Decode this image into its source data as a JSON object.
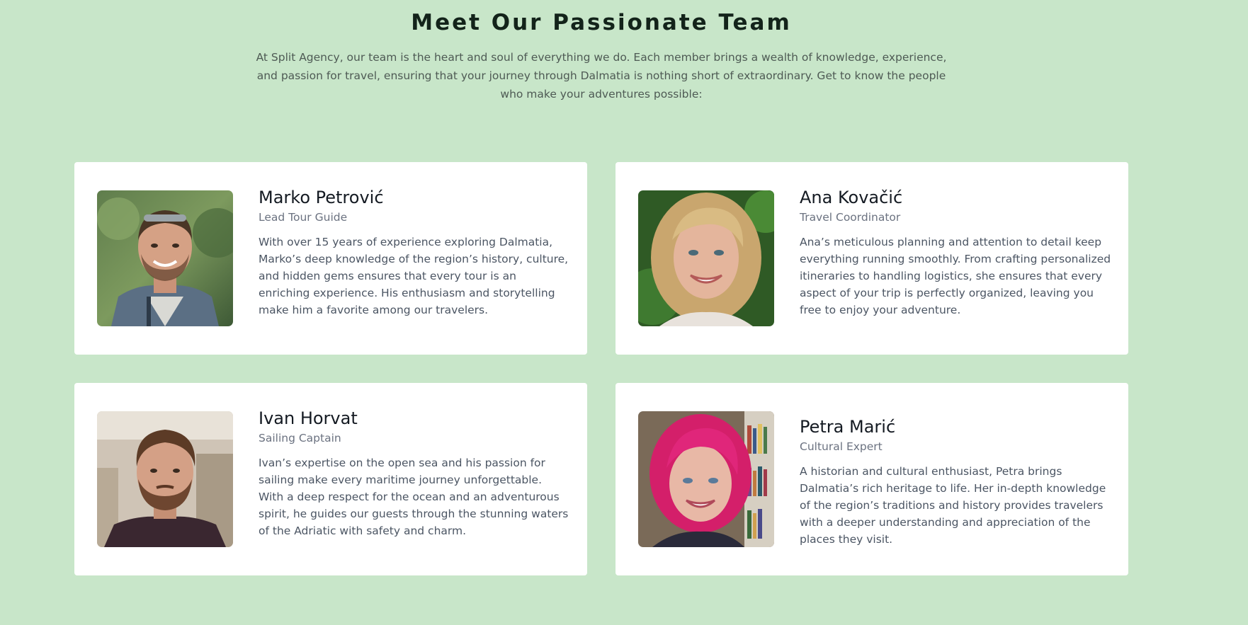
{
  "section": {
    "title": "Meet Our Passionate Team",
    "intro": "At Split Agency, our team is the heart and soul of everything we do. Each member brings a wealth of knowledge, experience, and passion for travel, ensuring that your journey through Dalmatia is nothing short of extraordinary. Get to know the people who make your adventures possible:"
  },
  "team": [
    {
      "name": "Marko Petrović",
      "role": "Lead Tour Guide",
      "bio": "With over 15 years of experience exploring Dalmatia, Marko’s deep knowledge of the region’s history, culture, and hidden gems ensures that every tour is an enriching experience. His enthusiasm and storytelling make him a favorite among our travelers."
    },
    {
      "name": "Ana Kovačić",
      "role": "Travel Coordinator",
      "bio": "Ana’s meticulous planning and attention to detail keep everything running smoothly. From crafting personalized itineraries to handling logistics, she ensures that every aspect of your trip is perfectly organized, leaving you free to enjoy your adventure."
    },
    {
      "name": "Ivan Horvat",
      "role": "Sailing Captain",
      "bio": "Ivan’s expertise on the open sea and his passion for sailing make every maritime journey unforgettable. With a deep respect for the ocean and an adventurous spirit, he guides our guests through the stunning waters of the Adriatic with safety and charm."
    },
    {
      "name": "Petra Marić",
      "role": "Cultural Expert",
      "bio": "A historian and cultural enthusiast, Petra brings Dalmatia’s rich heritage to life. Her in-depth knowledge of the region’s traditions and history provides travelers with a deeper understanding and appreciation of the places they visit."
    }
  ],
  "colors": {
    "page_background": "#c8e6c9",
    "card_background": "#ffffff",
    "heading": "#13231a",
    "body_text": "#4b5563",
    "muted_text": "#6b7280"
  }
}
